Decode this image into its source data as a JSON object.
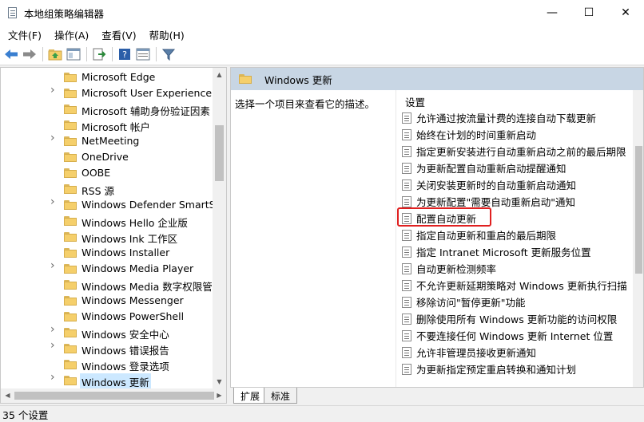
{
  "window": {
    "title": "本地组策略编辑器",
    "minimize": "—",
    "maximize": "☐",
    "close": "✕"
  },
  "menu": [
    "文件(F)",
    "操作(A)",
    "查看(V)",
    "帮助(H)"
  ],
  "tree": {
    "items": [
      {
        "label": "Microsoft Edge",
        "expandable": false
      },
      {
        "label": "Microsoft User Experience V",
        "expandable": true
      },
      {
        "label": "Microsoft 辅助身份验证因素",
        "expandable": false
      },
      {
        "label": "Microsoft 帐户",
        "expandable": false
      },
      {
        "label": "NetMeeting",
        "expandable": true
      },
      {
        "label": "OneDrive",
        "expandable": false
      },
      {
        "label": "OOBE",
        "expandable": false
      },
      {
        "label": "RSS 源",
        "expandable": false
      },
      {
        "label": "Windows Defender SmartSc",
        "expandable": true
      },
      {
        "label": "Windows Hello 企业版",
        "expandable": false
      },
      {
        "label": "Windows Ink 工作区",
        "expandable": false
      },
      {
        "label": "Windows Installer",
        "expandable": false
      },
      {
        "label": "Windows Media Player",
        "expandable": true
      },
      {
        "label": "Windows Media 数字权限管理",
        "expandable": false
      },
      {
        "label": "Windows Messenger",
        "expandable": false
      },
      {
        "label": "Windows PowerShell",
        "expandable": false
      },
      {
        "label": "Windows 安全中心",
        "expandable": true
      },
      {
        "label": "Windows 错误报告",
        "expandable": true
      },
      {
        "label": "Windows 登录选项",
        "expandable": false
      },
      {
        "label": "Windows 更新",
        "expandable": true,
        "selected": true
      }
    ]
  },
  "right": {
    "header": "Windows 更新",
    "description": "选择一个项目来查看它的描述。",
    "settings_header": "设置",
    "settings": [
      "允许通过按流量计费的连接自动下载更新",
      "始终在计划的时间重新启动",
      "指定更新安装进行自动重新启动之前的最后期限",
      "为更新配置自动重新启动提醒通知",
      "关闭安装更新时的自动重新启动通知",
      "为更新配置\"需要自动重新启动\"通知",
      "配置自动更新",
      "指定自动更新和重启的最后期限",
      "指定 Intranet Microsoft 更新服务位置",
      "自动更新检测频率",
      "不允许更新延期策略对 Windows 更新执行扫描",
      "移除访问\"暂停更新\"功能",
      "删除使用所有 Windows 更新功能的访问权限",
      "不要连接任何 Windows 更新 Internet 位置",
      "允许非管理员接收更新通知",
      "为更新指定预定重启转换和通知计划"
    ],
    "highlighted": "配置自动更新"
  },
  "tabs": [
    "扩展",
    "标准"
  ],
  "status": "35 个设置"
}
